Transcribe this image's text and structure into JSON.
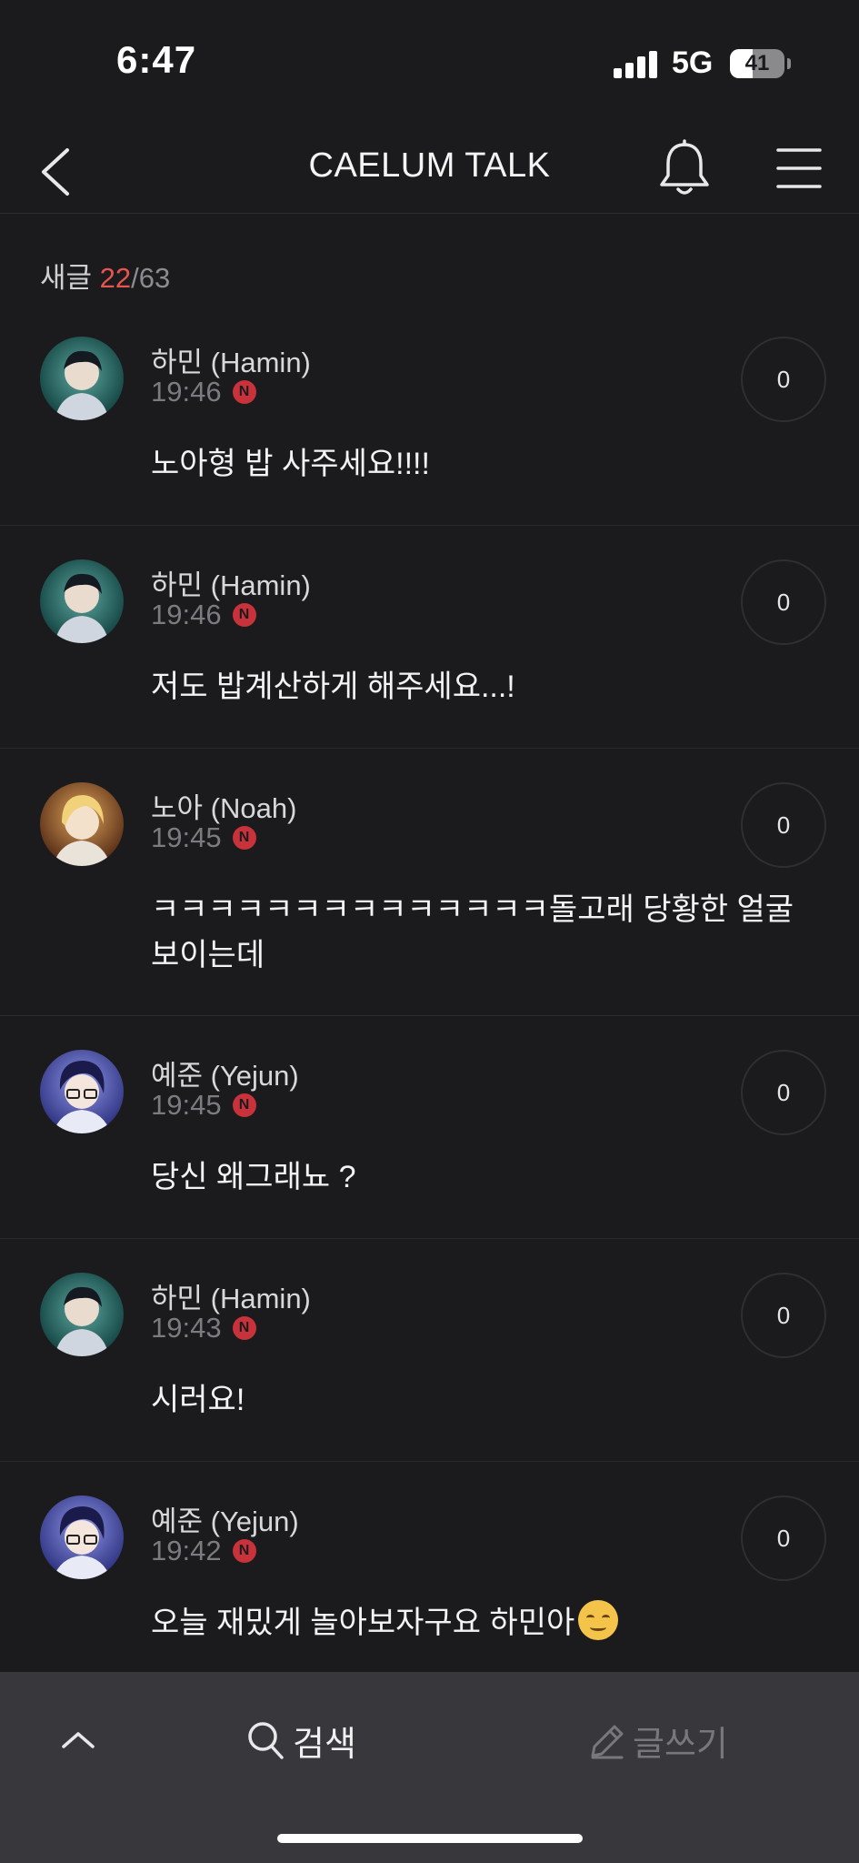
{
  "status_bar": {
    "time": "6:47",
    "network": "5G",
    "battery": "41",
    "battery_level": 0.41
  },
  "nav": {
    "title": "CAELUM TALK",
    "back_icon": "chevron-left-icon",
    "bell_icon": "bell-icon",
    "menu_icon": "hamburger-menu-icon"
  },
  "header": {
    "prefix": "새글",
    "current": "22",
    "total": "/63",
    "accent_color": "#e8554e"
  },
  "badge_label": "N",
  "posts": [
    {
      "author": "하민 (Hamin)",
      "time": "19:46",
      "likes": "0",
      "text": "노아형 밥 사주세요!!!!",
      "avatar": "hamin"
    },
    {
      "author": "하민 (Hamin)",
      "time": "19:46",
      "likes": "0",
      "text": "저도 밥계산하게 해주세요...!",
      "avatar": "hamin"
    },
    {
      "author": "노아 (Noah)",
      "time": "19:45",
      "likes": "0",
      "text": "ㅋㅋㅋㅋㅋㅋㅋㅋㅋㅋㅋㅋㅋㅋ돌고래 당황한 얼굴 보이는데",
      "avatar": "noah"
    },
    {
      "author": "예준 (Yejun)",
      "time": "19:45",
      "likes": "0",
      "text": "당신 왜그래뇨 ?",
      "avatar": "yejun"
    },
    {
      "author": "하민 (Hamin)",
      "time": "19:43",
      "likes": "0",
      "text": "시러요!",
      "avatar": "hamin"
    },
    {
      "author": "예준 (Yejun)",
      "time": "19:42",
      "likes": "0",
      "text": "오늘 재밌게 놀아보자구요 하민아",
      "emoji": "smiling-face-emoji",
      "avatar": "yejun"
    }
  ],
  "bottom_bar": {
    "search_label": "검색",
    "write_label": "글쓰기",
    "search_icon": "search-icon",
    "write_icon": "pencil-icon",
    "top_icon": "chevron-up-icon"
  }
}
